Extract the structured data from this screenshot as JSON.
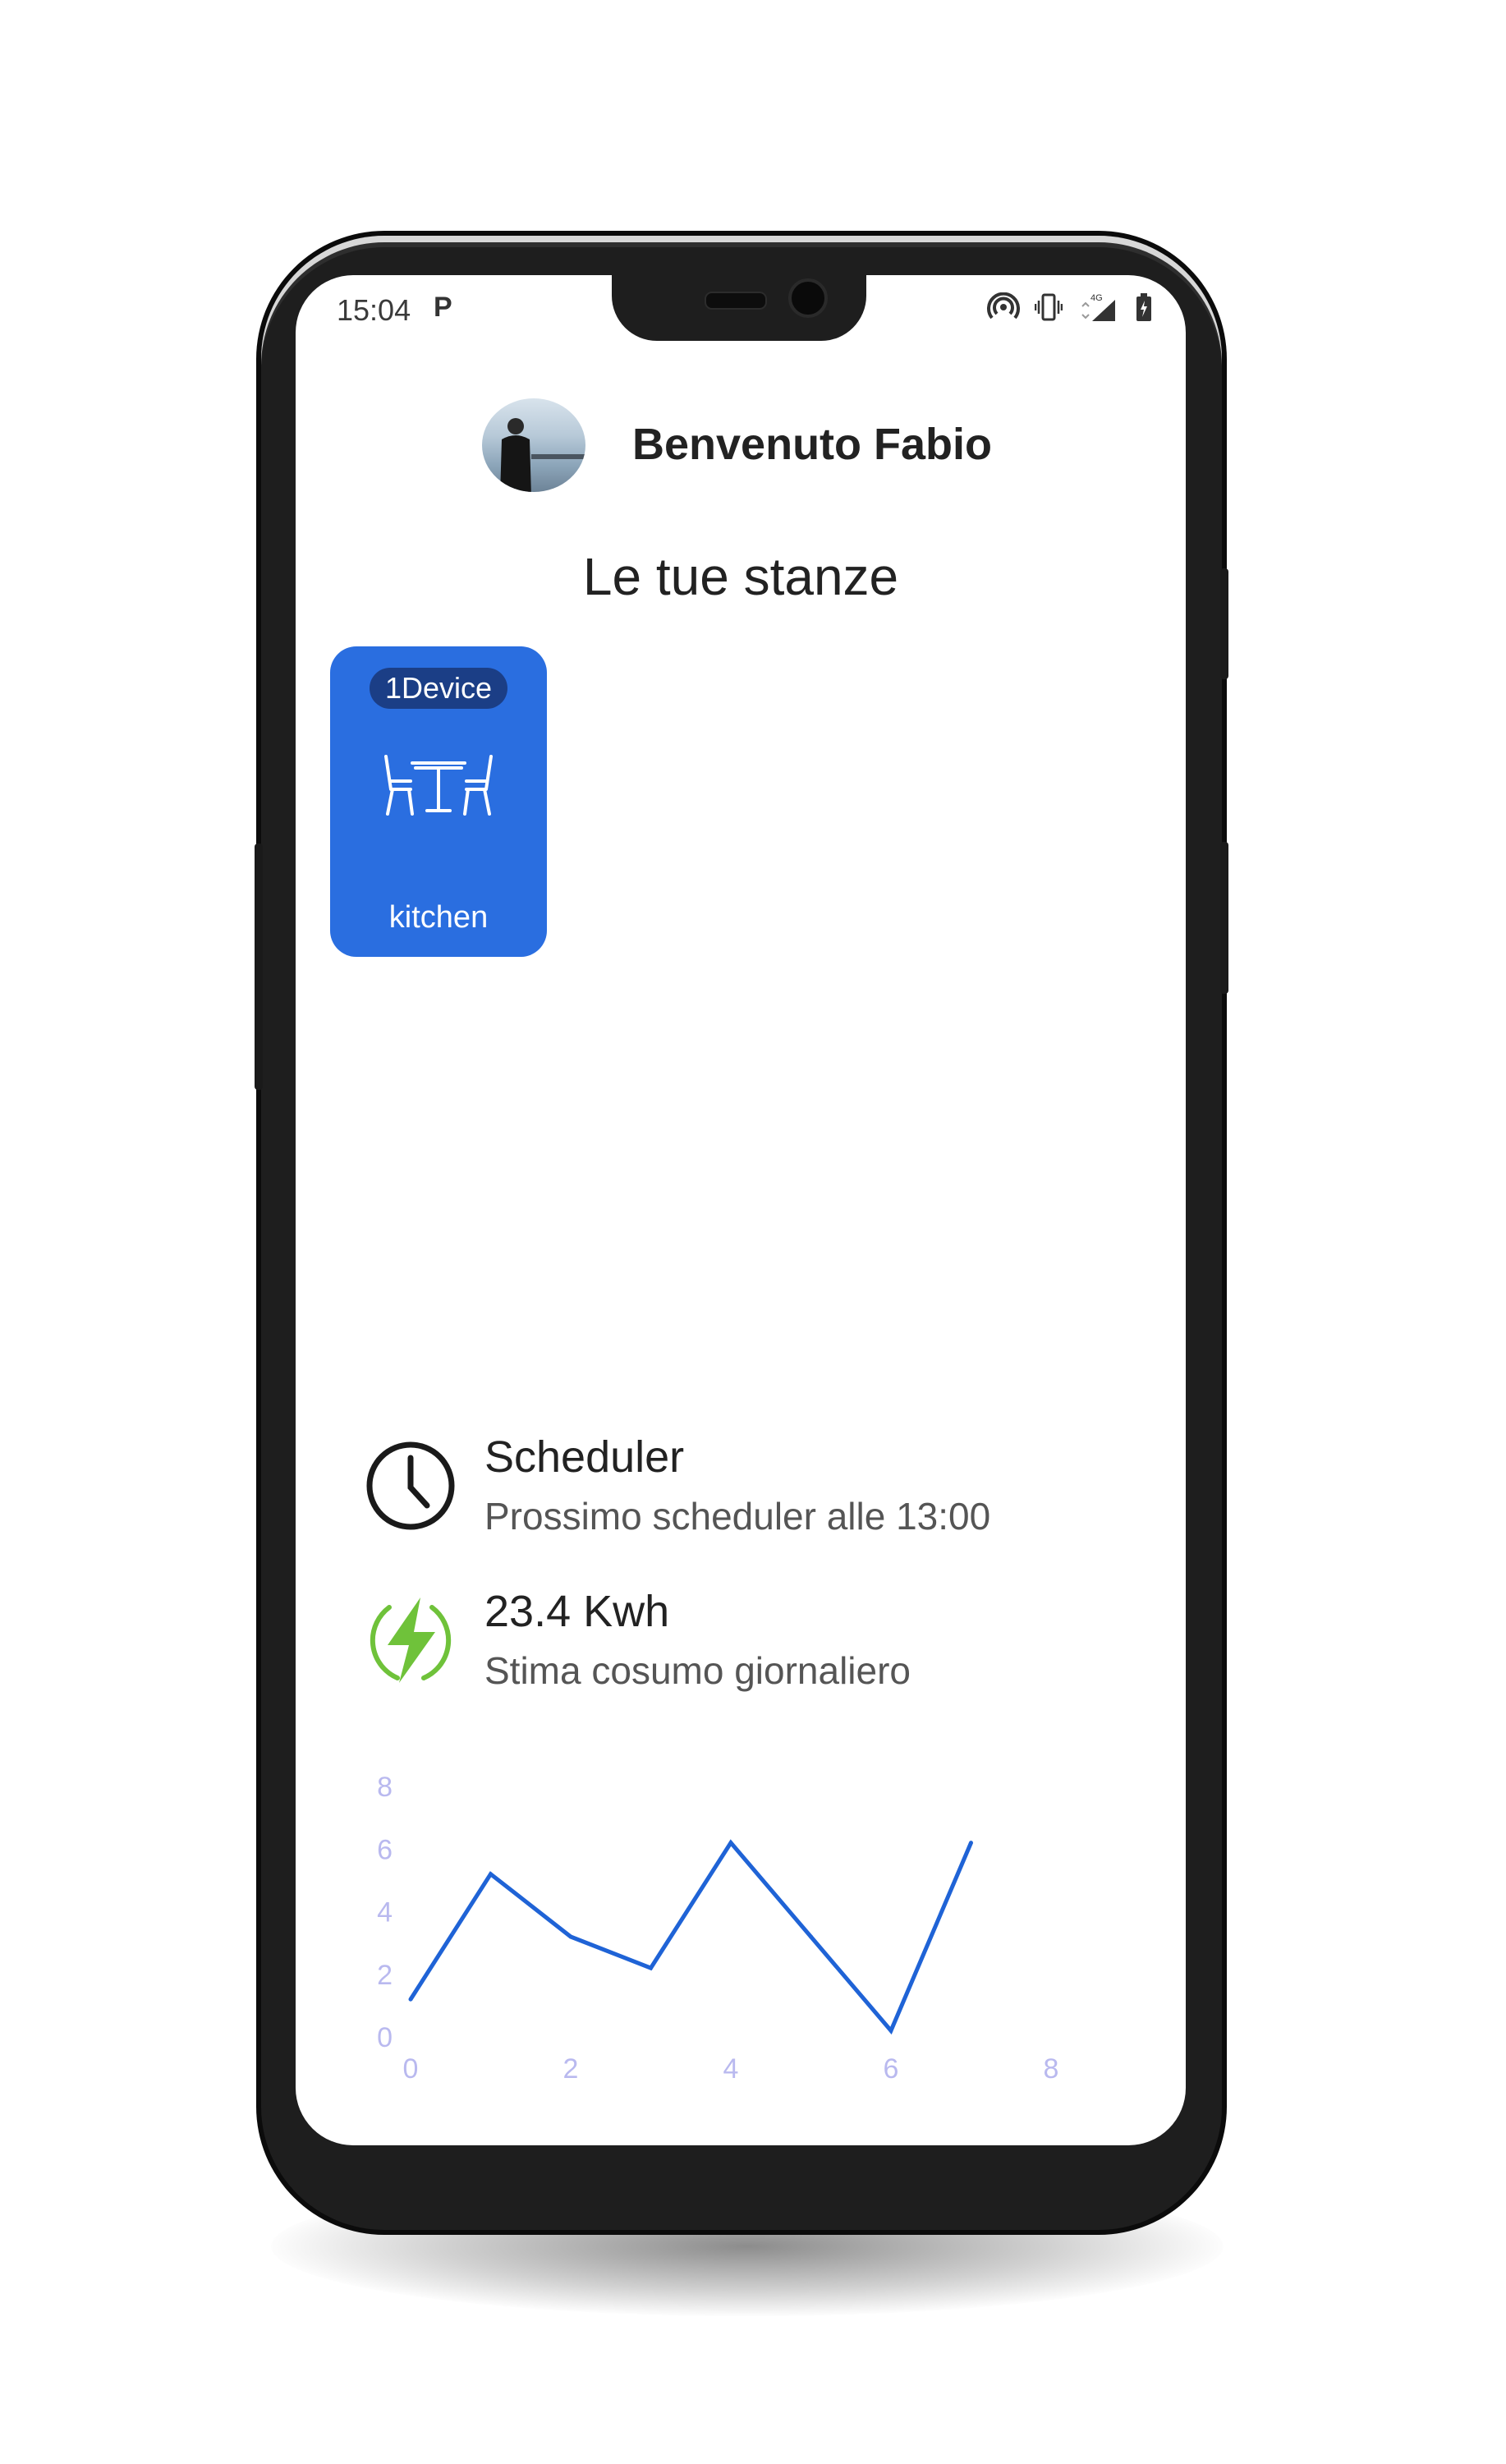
{
  "status_bar": {
    "time": "15:04",
    "app_indicator": "P",
    "icons": [
      "hotspot-icon",
      "vibrate-icon",
      "signal-4g-icon",
      "battery-charging-icon"
    ],
    "network_label": "4G"
  },
  "header": {
    "greeting": "Benvenuto Fabio"
  },
  "rooms": {
    "title": "Le tue stanze",
    "items": [
      {
        "badge": "1Device",
        "name": "kitchen",
        "icon": "dining-table-icon",
        "color": "#2a6ee0"
      }
    ]
  },
  "scheduler": {
    "title": "Scheduler",
    "subtitle": "Prossimo scheduler alle 13:00",
    "icon": "clock-icon"
  },
  "energy": {
    "title": "23.4 Kwh",
    "subtitle": "Stima cosumo giornaliero",
    "icon": "lightning-icon",
    "color": "#6fc23a"
  },
  "chart_data": {
    "type": "line",
    "x": [
      0,
      1,
      2,
      3,
      4,
      5,
      6,
      7
    ],
    "series": [
      {
        "values": [
          1.2,
          5.2,
          3.2,
          2.2,
          6.2,
          3.2,
          0.2,
          6.2
        ],
        "color": "#1f63d6"
      }
    ],
    "xlim": [
      0,
      8
    ],
    "ylim": [
      0,
      8
    ],
    "x_ticks": [
      "0",
      "2",
      "4",
      "6",
      "8"
    ],
    "y_ticks": [
      "0",
      "2",
      "4",
      "6",
      "8"
    ],
    "grid": false,
    "title": "",
    "xlabel": "",
    "ylabel": ""
  }
}
